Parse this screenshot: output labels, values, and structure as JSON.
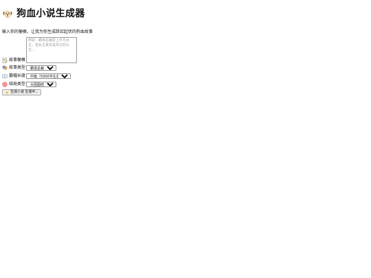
{
  "header": {
    "title": "狗血小说生成器",
    "icon": "dog-face-icon"
  },
  "intro": {
    "text": "输入你的梗概，让我为你生成跌宕起伏的狗血故事"
  },
  "form": {
    "synopsis": {
      "label": "故事梗概",
      "icon": "memo-icon",
      "placeholder": "例如：霸道总裁爱上平凡女主，但女主其实是失忆的公主...",
      "value": ""
    },
    "story_type": {
      "label": "故事类型",
      "icon": "theater-masks-icon",
      "selected": "霸道总裁爱"
    },
    "length": {
      "label": "篇幅长度",
      "icon": "open-book-icon",
      "selected": "中篇（5000字左右）"
    },
    "ending": {
      "label": "结局类型",
      "icon": "target-icon",
      "selected": "大团圆结局"
    },
    "generate_button": {
      "label": "生成小说 生成中...",
      "icon": "sparkles-icon"
    }
  },
  "colors": {
    "background": "#ffffff",
    "text": "#111111",
    "border": "#9a9a9a",
    "button_bg": "#efefef"
  }
}
